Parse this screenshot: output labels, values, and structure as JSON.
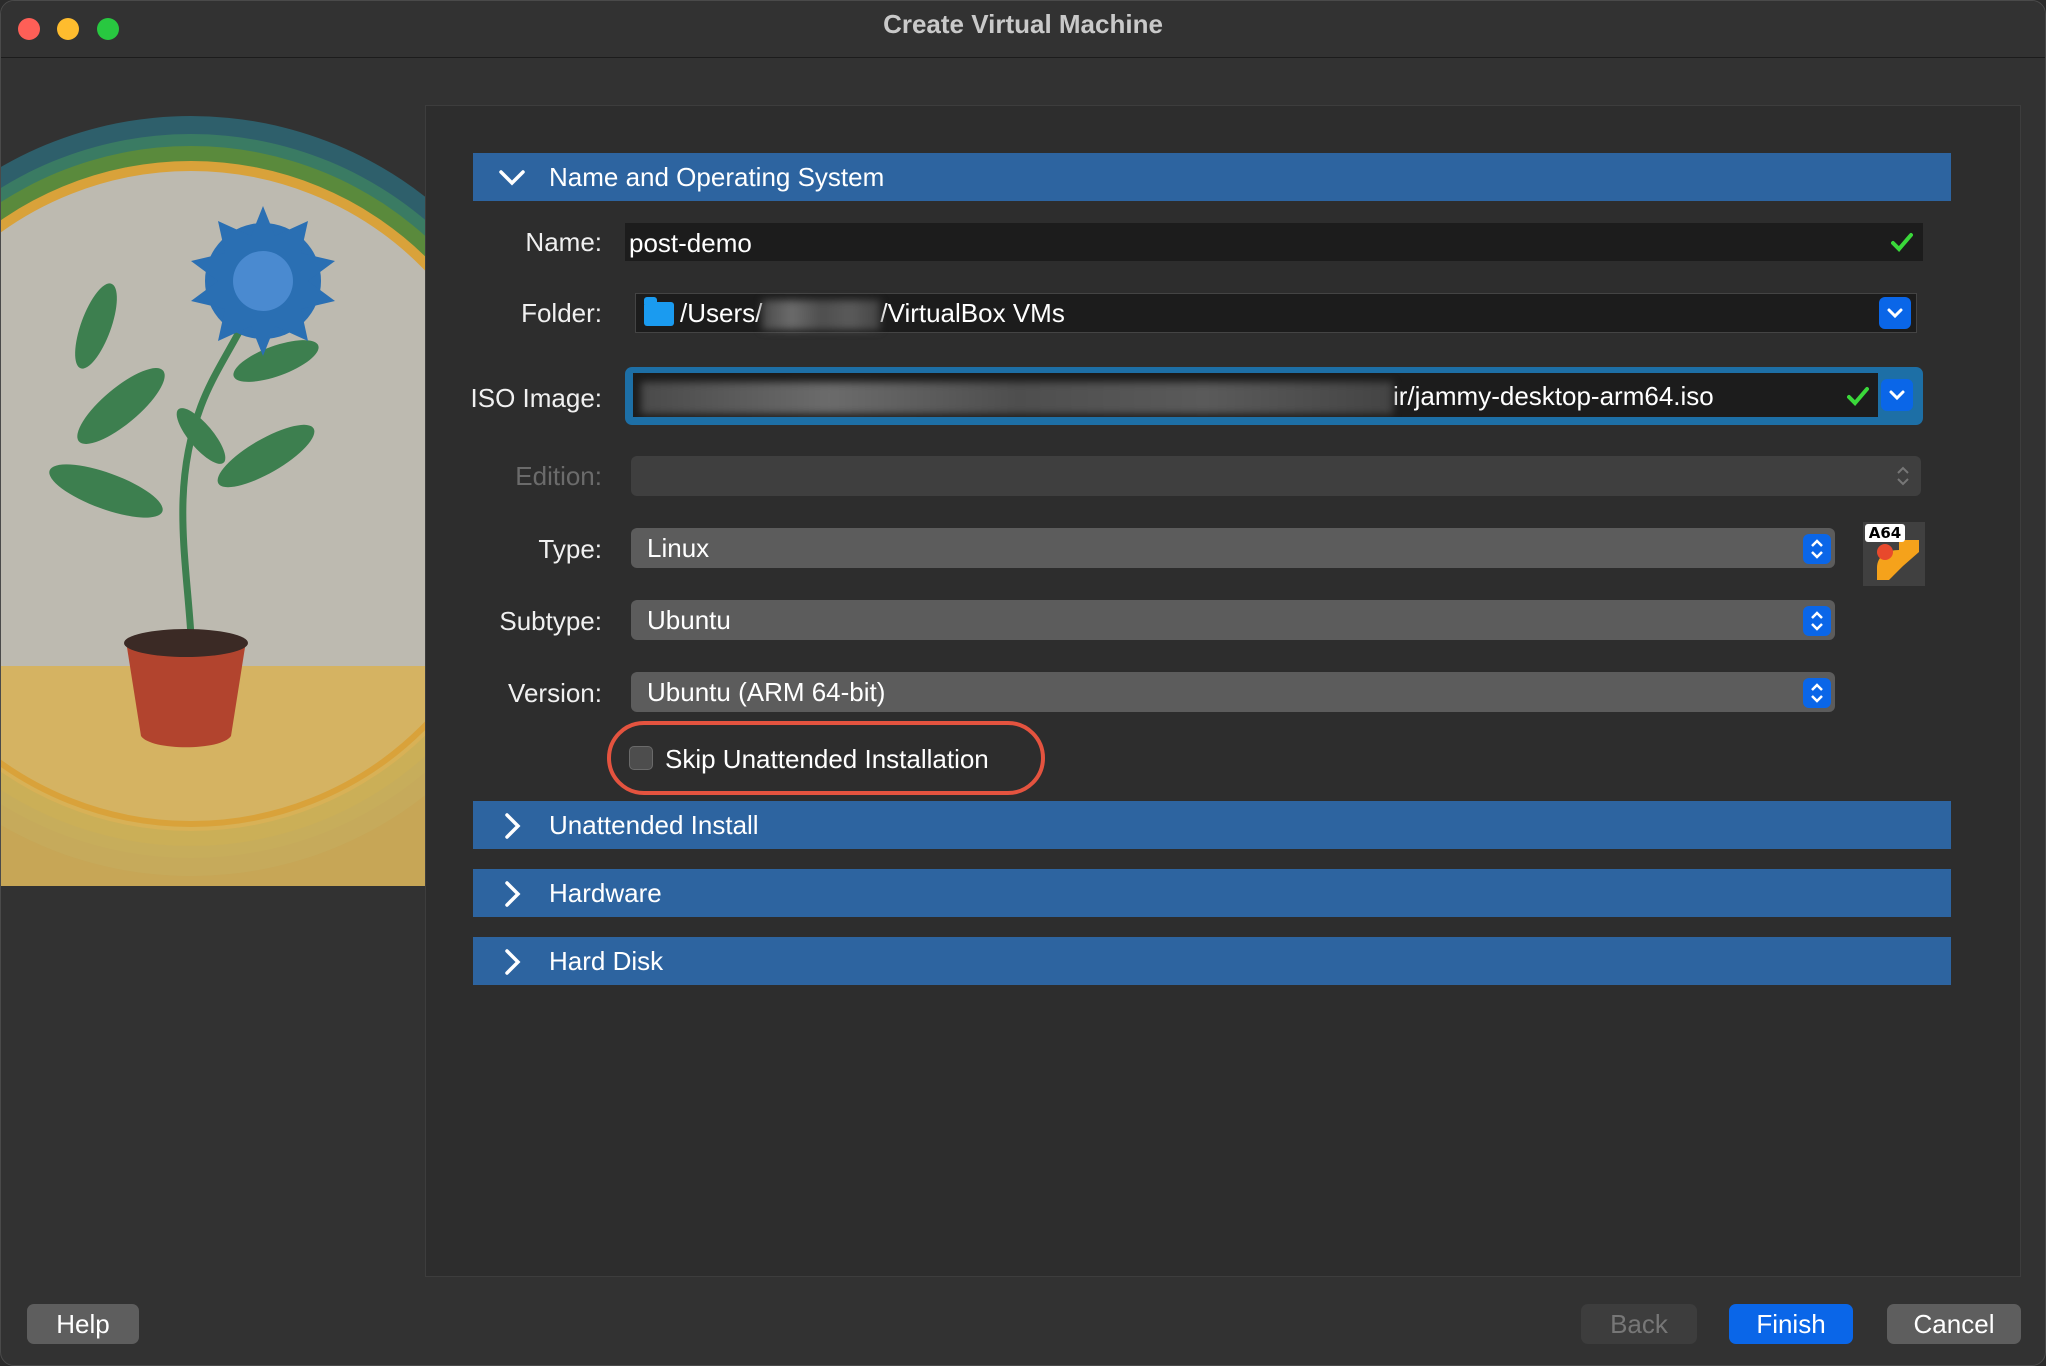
{
  "window": {
    "title": "Create Virtual Machine"
  },
  "sections": {
    "name_os": "Name and Operating System",
    "unattended": "Unattended Install",
    "hardware": "Hardware",
    "hard_disk": "Hard Disk"
  },
  "form": {
    "name_label": "Name:",
    "name_value": "post-demo",
    "folder_label": "Folder:",
    "folder_prefix": "/Users/",
    "folder_suffix": "/VirtualBox VMs",
    "iso_label": "ISO Image:",
    "iso_value_visible": "ir/jammy-desktop-arm64.iso",
    "edition_label": "Edition:",
    "edition_value": "",
    "type_label": "Type:",
    "type_value": "Linux",
    "subtype_label": "Subtype:",
    "subtype_value": "Ubuntu",
    "version_label": "Version:",
    "version_value": "Ubuntu (ARM 64-bit)",
    "os_badge": "A64",
    "skip_label": "Skip Unattended Installation",
    "skip_checked": false
  },
  "buttons": {
    "help": "Help",
    "back": "Back",
    "finish": "Finish",
    "cancel": "Cancel"
  },
  "colors": {
    "section_header": "#2d64a0",
    "accent": "#0a66e8",
    "highlight": "#e4533f",
    "valid_check": "#3ad83a"
  }
}
